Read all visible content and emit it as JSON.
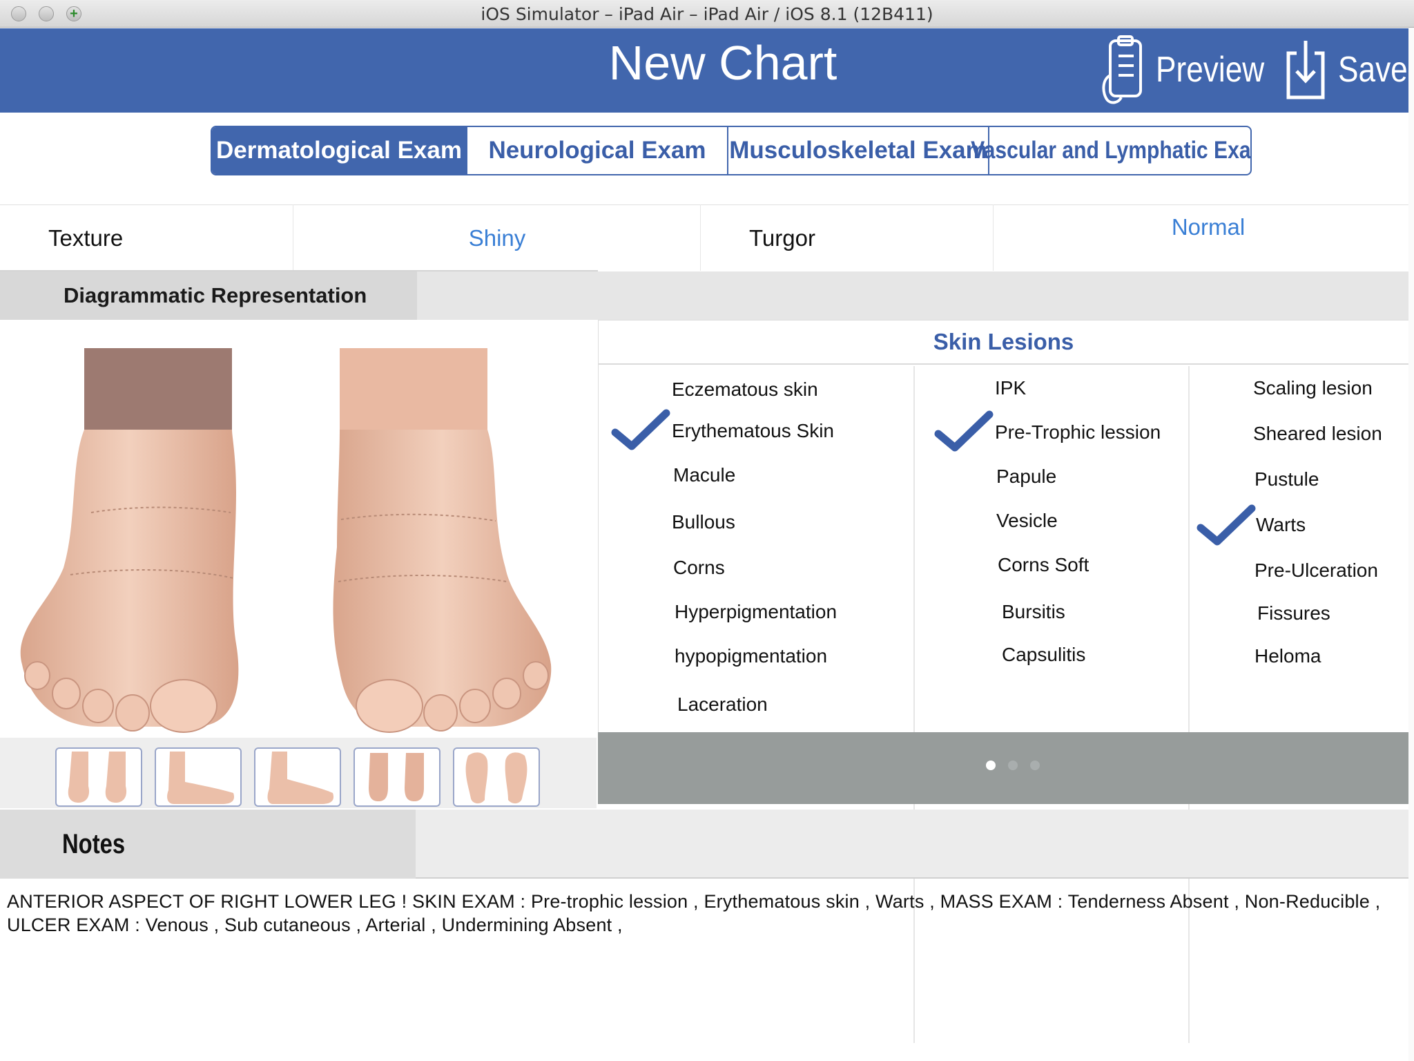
{
  "window": {
    "title": "iOS Simulator – iPad Air – iPad Air / iOS 8.1 (12B411)"
  },
  "navbar": {
    "title": "New Chart",
    "preview_label": "Preview",
    "save_label": "Save"
  },
  "tabs": [
    {
      "label": "Dermatological Exam",
      "active": true
    },
    {
      "label": "Neurological Exam",
      "active": false
    },
    {
      "label": "Musculoskeletal Exam",
      "active": false
    },
    {
      "label": "Vascular and Lymphatic Exam",
      "active": false
    }
  ],
  "fields": {
    "texture": {
      "label": "Texture",
      "value": "Shiny"
    },
    "turgor": {
      "label": "Turgor",
      "value": "Normal"
    }
  },
  "diagram": {
    "header": "Diagrammatic Representation",
    "thumbnail_count": 5
  },
  "skin_lesions": {
    "title": "Skin Lesions",
    "columns": [
      [
        {
          "label": "Eczematous skin",
          "checked": false
        },
        {
          "label": "Erythematous Skin",
          "checked": true
        },
        {
          "label": "Macule",
          "checked": false
        },
        {
          "label": "Bullous",
          "checked": false
        },
        {
          "label": "Corns",
          "checked": false
        },
        {
          "label": "Hyperpigmentation",
          "checked": false
        },
        {
          "label": "hypopigmentation",
          "checked": false
        },
        {
          "label": "Laceration",
          "checked": false
        }
      ],
      [
        {
          "label": "IPK",
          "checked": false
        },
        {
          "label": "Pre-Trophic lession",
          "checked": true
        },
        {
          "label": "Papule",
          "checked": false
        },
        {
          "label": "Vesicle",
          "checked": false
        },
        {
          "label": "Corns Soft",
          "checked": false
        },
        {
          "label": "Bursitis",
          "checked": false
        },
        {
          "label": "Capsulitis",
          "checked": false
        }
      ],
      [
        {
          "label": "Scaling lesion",
          "checked": false
        },
        {
          "label": "Sheared lesion",
          "checked": false
        },
        {
          "label": "Pustule",
          "checked": false
        },
        {
          "label": "Warts",
          "checked": true
        },
        {
          "label": "Pre-Ulceration",
          "checked": false
        },
        {
          "label": "Fissures",
          "checked": false
        },
        {
          "label": "Heloma",
          "checked": false
        }
      ]
    ],
    "pager": {
      "pages": 3,
      "current": 1
    }
  },
  "notes": {
    "label": "Notes",
    "text": "ANTERIOR ASPECT OF RIGHT LOWER LEG  ! SKIN EXAM : Pre-trophic lession  , Erythematous skin  , Warts  , MASS EXAM :  Tenderness Absent ,  Non-Reducible  , ULCER EXAM : Venous  , Sub cutaneous  ,  Arterial  ,     Undermining Absent ,"
  },
  "colors": {
    "brand_blue": "#4166ad",
    "link_blue": "#3a7fd5",
    "check_blue": "#3a5ea8"
  }
}
